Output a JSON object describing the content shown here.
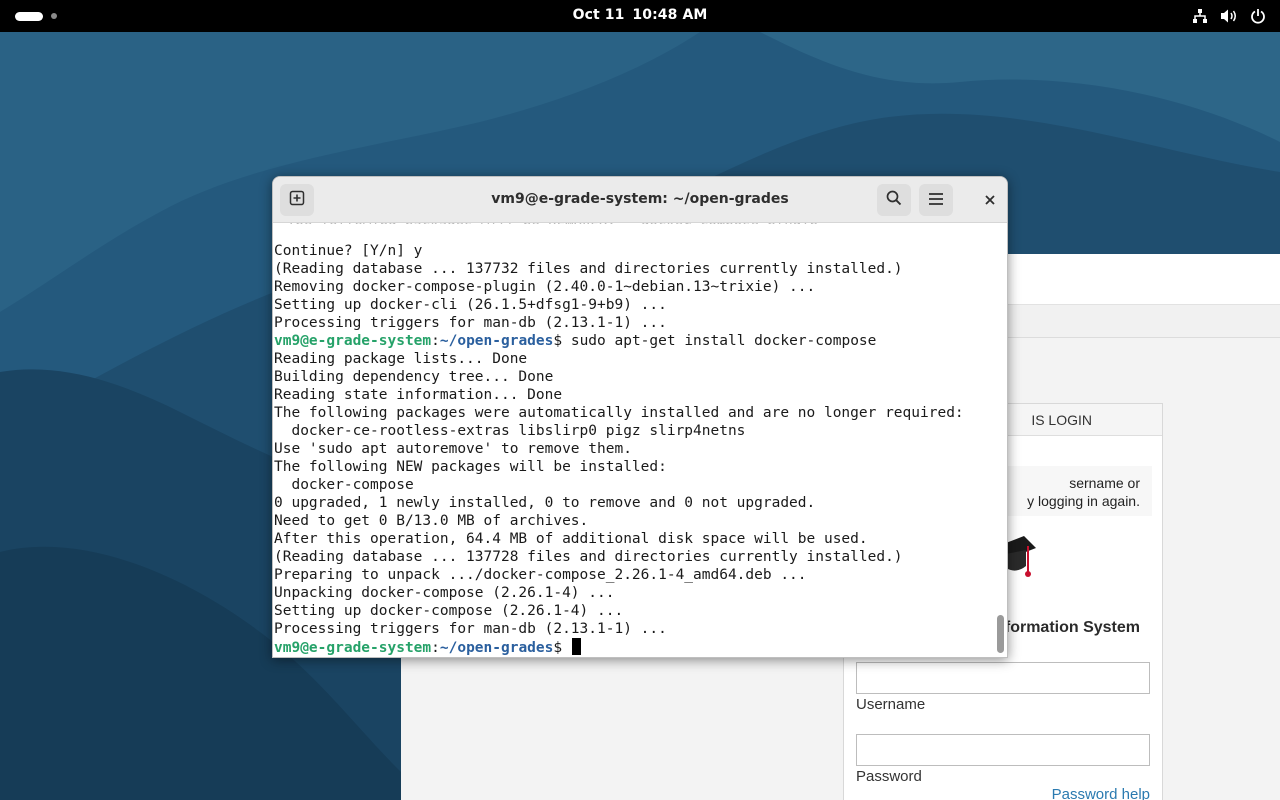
{
  "topbar": {
    "activities_icon": "activities-pill-icon",
    "date": "Oct 11",
    "time": "10:48 AM",
    "tray_icons": [
      "network-icon",
      "volume-icon",
      "power-icon"
    ]
  },
  "background_page": {
    "login_header": "IS LOGIN",
    "message_line1": "sername or",
    "message_line2": "y logging in again.",
    "system_title": "formation System",
    "username_label": "Username",
    "password_label": "Password",
    "password_help": "Password help"
  },
  "terminal": {
    "title": "vm9@e-grade-system: ~/open-grades",
    "buttons": [
      "new-tab-icon",
      "search-icon",
      "menu-icon",
      "close-icon"
    ],
    "lines": [
      {
        "text": "Continue? [Y/n] y"
      },
      {
        "text": "(Reading database ... 137732 files and directories currently installed.)"
      },
      {
        "text": "Removing docker-compose-plugin (2.40.0-1~debian.13~trixie) ..."
      },
      {
        "text": "Setting up docker-cli (26.1.5+dfsg1-9+b9) ..."
      },
      {
        "text": "Processing triggers for man-db (2.13.1-1) ..."
      },
      {
        "prompt_user": "vm9@e-grade-system",
        "prompt_sep": ":",
        "prompt_path": "~/open-grades",
        "prompt_end": "$ ",
        "command": "sudo apt-get install docker-compose"
      },
      {
        "text": "Reading package lists... Done"
      },
      {
        "text": "Building dependency tree... Done"
      },
      {
        "text": "Reading state information... Done"
      },
      {
        "text": "The following packages were automatically installed and are no longer required:"
      },
      {
        "text": "  docker-ce-rootless-extras libslirp0 pigz slirp4netns"
      },
      {
        "text": "Use 'sudo apt autoremove' to remove them."
      },
      {
        "text": "The following NEW packages will be installed:"
      },
      {
        "text": "  docker-compose"
      },
      {
        "text": "0 upgraded, 1 newly installed, 0 to remove and 0 not upgraded."
      },
      {
        "text": "Need to get 0 B/13.0 MB of archives."
      },
      {
        "text": "After this operation, 64.4 MB of additional disk space will be used."
      },
      {
        "text": "(Reading database ... 137728 files and directories currently installed.)"
      },
      {
        "text": "Preparing to unpack .../docker-compose_2.26.1-4_amd64.deb ..."
      },
      {
        "text": "Unpacking docker-compose (2.26.1-4) ..."
      },
      {
        "text": "Setting up docker-compose (2.26.1-4) ..."
      },
      {
        "text": "Processing triggers for man-db (2.13.1-1) ..."
      },
      {
        "prompt_user": "vm9@e-grade-system",
        "prompt_sep": ":",
        "prompt_path": "~/open-grades",
        "prompt_end": "$ ",
        "command": "",
        "cursor": true
      }
    ]
  },
  "colors": {
    "prompt_user": "#26a269",
    "prompt_path": "#2a5f9e",
    "wallpaper": "#1f4e6f",
    "link": "#2a7ab0"
  }
}
